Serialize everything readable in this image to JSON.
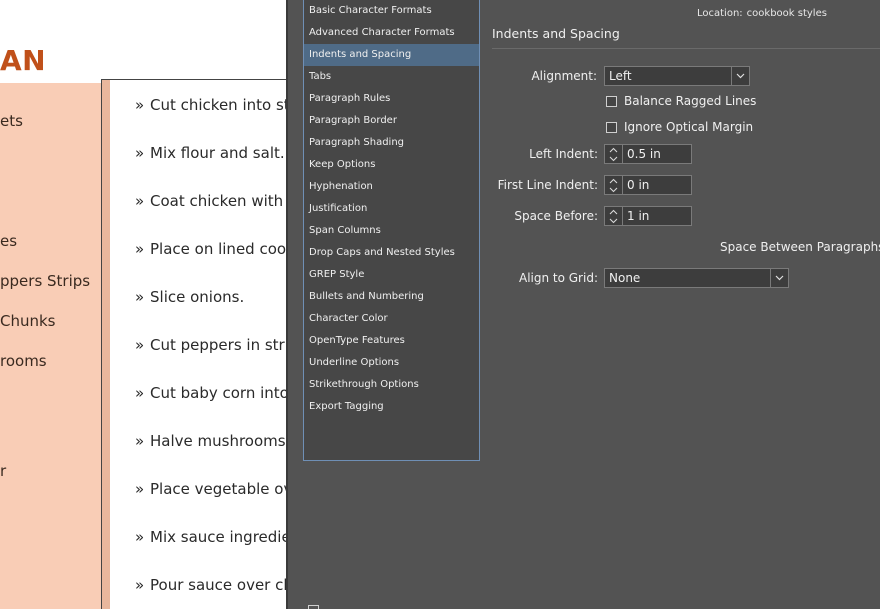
{
  "document": {
    "title": "AN",
    "ingredients": [
      "ets",
      "es",
      "ppers Strips",
      "Chunks",
      "rooms",
      "r"
    ],
    "steps": [
      "Cut chicken into stri",
      "Mix flour and salt.",
      "Coat chicken with fl",
      "Place on lined cook",
      "Slice onions.",
      "Cut peppers in strip",
      "Cut baby corn into c",
      "Halve mushrooms.",
      "Place vegetable ov",
      "Mix sauce ingredie",
      "Pour sauce over ch"
    ],
    "bullet": "»"
  },
  "dialog": {
    "location_label": "Location:",
    "location_value": "cookbook styles",
    "categories": [
      "Basic Character Formats",
      "Advanced Character Formats",
      "Indents and Spacing",
      "Tabs",
      "Paragraph Rules",
      "Paragraph Border",
      "Paragraph Shading",
      "Keep Options",
      "Hyphenation",
      "Justification",
      "Span Columns",
      "Drop Caps and Nested Styles",
      "GREP Style",
      "Bullets and Numbering",
      "Character Color",
      "OpenType Features",
      "Underline Options",
      "Strikethrough Options",
      "Export Tagging"
    ],
    "selected_category": "Indents and Spacing",
    "section_title": "Indents and Spacing",
    "alignment_label": "Alignment:",
    "alignment_value": "Left",
    "balance_label": "Balance Ragged Lines",
    "optical_label": "Ignore Optical Margin",
    "left_indent_label": "Left Indent:",
    "left_indent_value": "0.5 in",
    "first_line_label": "First Line Indent:",
    "first_line_value": "0 in",
    "space_before_label": "Space Before:",
    "space_before_value": "1 in",
    "space_between_label": "Space Between Paragraphs U",
    "align_grid_label": "Align to Grid:",
    "align_grid_value": "None"
  },
  "colors": {
    "dialog_bg": "#535353",
    "selection": "#4f6b87",
    "list_border": "#6f8fb5",
    "title_accent": "#c0501a",
    "sidebar_fill": "#f9cdb6"
  }
}
